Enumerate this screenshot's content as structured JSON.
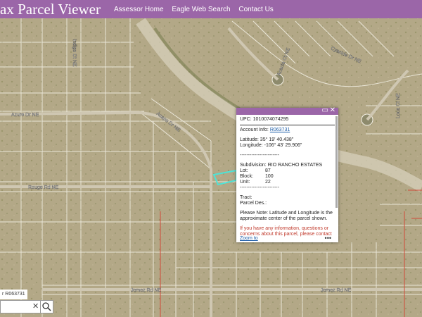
{
  "header": {
    "title": "ax Parcel Viewer",
    "nav": [
      "Assessor Home",
      "Eagle Web Search",
      "Contact Us"
    ]
  },
  "streets": {
    "azure": "Azure Dr NE",
    "acapo": "Acapo Dr NE",
    "rouge": "Rouge Rd NE",
    "jemez_left": "Jemez Rd NE",
    "jemez_right": "Jemez Rd NE",
    "indigo": "Indigo Ct NE",
    "cyanide": "Cyanide Dr NE",
    "acacia": "Acacia Ct NE",
    "loca": "Loca Ct NE"
  },
  "popup": {
    "upc": "UPC: 1010074074295",
    "account_label": "Account Info:",
    "account_link": "R063731",
    "latitude": "Latitude: 35° 19' 40.438\"",
    "longitude": "Longitude: -106° 43' 29.906\"",
    "separator": "------------------------",
    "subdivision": "Subdivision: RIO RANCHO ESTATES",
    "lot_label": "Lot:",
    "lot_value": "87",
    "block_label": "Block:",
    "block_value": "100",
    "unit_label": "Unit:",
    "unit_value": "22",
    "tract": "Tract:",
    "parcel_des": "Parcel Des.:",
    "note": "Please Note: Latitude and Longitude is the approximate center of the parcel shown.",
    "contact_note": "If you have any information, questions or concerns about this parcel, please contact",
    "zoom": "Zoom to",
    "more": "•••"
  },
  "search": {
    "label": "r R063731",
    "clear": "✕"
  },
  "colors": {
    "header": "#9b66a8",
    "highlight": "#4fe3d6",
    "boundary": "#c0392b"
  }
}
